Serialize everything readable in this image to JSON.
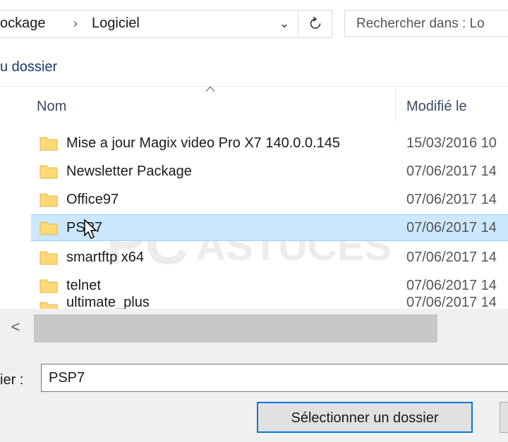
{
  "address_bar": {
    "crumbs": [
      "ockage",
      "Logiciel"
    ],
    "separator": "›",
    "dropdown_glyph": "⌄",
    "search_placeholder": "Rechercher dans : Lo"
  },
  "toolbar": {
    "new_folder_label": "u dossier"
  },
  "columns": {
    "name": "Nom",
    "modified": "Modifié le"
  },
  "files": [
    {
      "name": "Mise a jour Magix video Pro X7 140.0.0.145",
      "date": "15/03/2016 10"
    },
    {
      "name": "Newsletter Package",
      "date": "07/06/2017 14"
    },
    {
      "name": "Office97",
      "date": "07/06/2017 14"
    },
    {
      "name": "PSP7",
      "date": "07/06/2017 14",
      "selected": true
    },
    {
      "name": "smartftp x64",
      "date": "07/06/2017 14"
    },
    {
      "name": "telnet",
      "date": "07/06/2017 14"
    },
    {
      "name": "ultimate_plus",
      "date": "07/06/2017 14"
    }
  ],
  "watermark": {
    "text1": "PC",
    "text2": "ASTUCES"
  },
  "scroll": {
    "left_arrow": "<"
  },
  "footer": {
    "filename_label": "ier :",
    "filename_value": "PSP7",
    "select_button": "Sélectionner un dossier"
  },
  "colors": {
    "selection": "#cce8ff",
    "folder": "#ffd978",
    "accent": "#0078d7"
  }
}
